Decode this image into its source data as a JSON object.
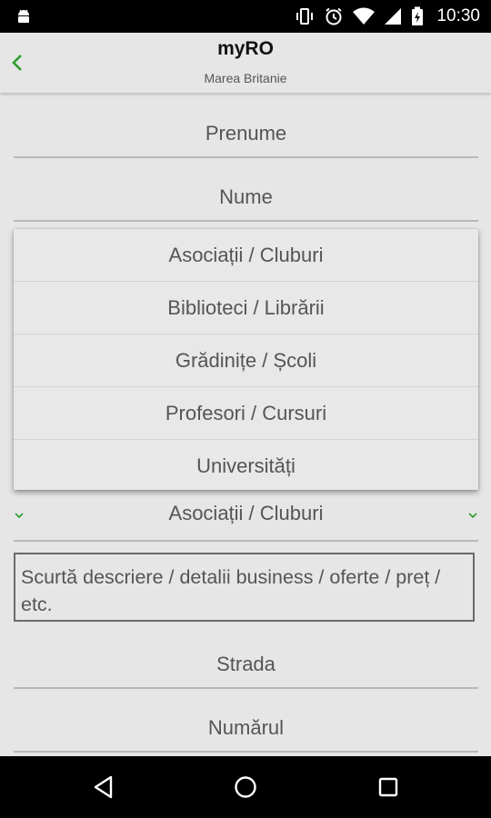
{
  "status_bar": {
    "time": "10:30",
    "icons": [
      "android-icon",
      "vibrate-icon",
      "alarm-icon",
      "wifi-icon",
      "signal-icon",
      "battery-charging-icon"
    ]
  },
  "header": {
    "title": "myRO",
    "subtitle": "Marea Britanie",
    "back_icon": "chevron-left-icon",
    "accent_color": "#2e9c2e"
  },
  "form": {
    "prenume_placeholder": "Prenume",
    "nume_placeholder": "Nume",
    "category_selected": "Asociații / Cluburi",
    "description_placeholder": "Scurtă descriere / detalii business / oferte / preț / etc.",
    "strada_placeholder": "Strada",
    "numar_placeholder": "Numărul"
  },
  "dropdown": {
    "options": [
      "Asociații / Cluburi",
      "Biblioteci / Librării",
      "Grădinițe / Școli",
      "Profesori / Cursuri",
      "Universități"
    ]
  },
  "nav_bar": {
    "buttons": [
      "back-triangle-icon",
      "home-circle-icon",
      "recents-square-icon"
    ]
  }
}
